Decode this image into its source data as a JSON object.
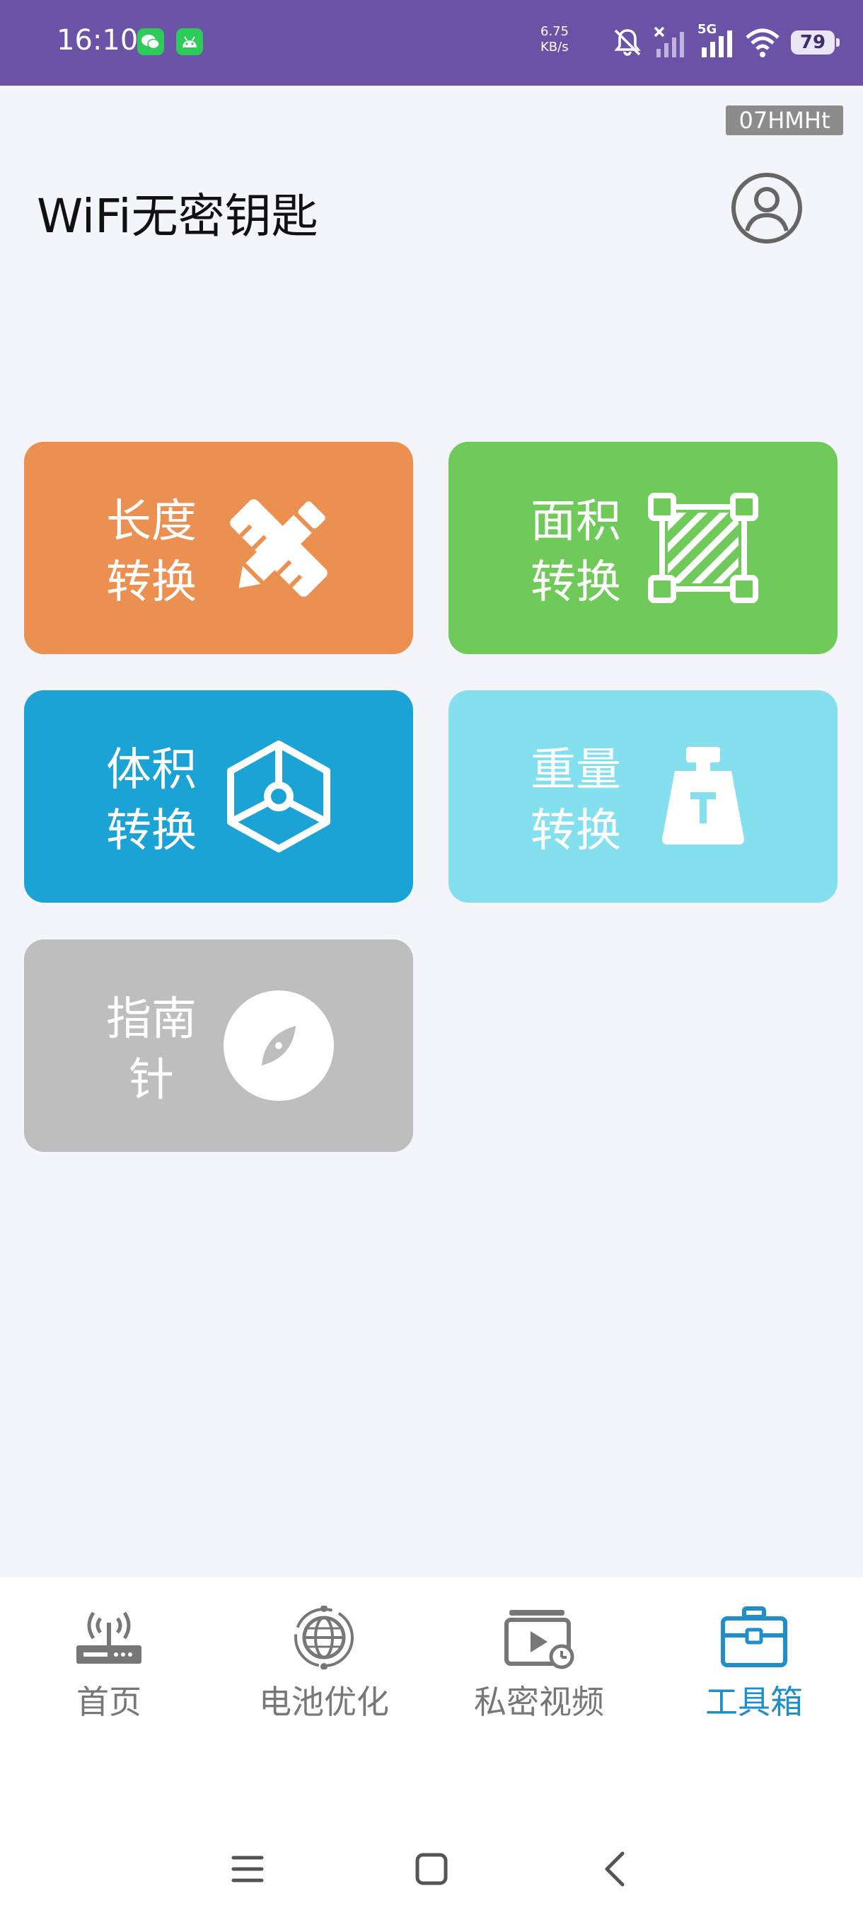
{
  "status_bar": {
    "time": "16:10",
    "net_speed_value": "6.75",
    "net_speed_unit": "KB/s",
    "network": "5G",
    "battery": "79",
    "icons": [
      "wechat-icon",
      "android-icon",
      "mute-icon",
      "no-signal-icon",
      "signal-icon",
      "wifi-icon",
      "battery-icon"
    ]
  },
  "app": {
    "tag": "07HMHt",
    "title": "WiFi无密钥匙",
    "account_icon": "account-icon"
  },
  "tools": [
    {
      "line1": "长度",
      "line2": "转换",
      "icon": "ruler-pencil-icon",
      "color": "#ec9052"
    },
    {
      "line1": "面积",
      "line2": "转换",
      "icon": "area-icon",
      "color": "#6fca5a"
    },
    {
      "line1": "体积",
      "line2": "转换",
      "icon": "cube-icon",
      "color": "#1aa3d4"
    },
    {
      "line1": "重量",
      "line2": "转换",
      "icon": "weight-icon",
      "color": "#84e0ef"
    },
    {
      "line1": "指南",
      "line2": "针",
      "icon": "compass-icon",
      "color": "#bebebe"
    }
  ],
  "nav": {
    "items": [
      {
        "label": "首页",
        "icon": "router-icon",
        "active": false
      },
      {
        "label": "电池优化",
        "icon": "globe-icon",
        "active": false
      },
      {
        "label": "私密视频",
        "icon": "video-icon",
        "active": false
      },
      {
        "label": "工具箱",
        "icon": "toolbox-icon",
        "active": true
      }
    ],
    "active_color": "#1e8fc9",
    "inactive_color": "#777777"
  },
  "system_nav": [
    "menu-icon",
    "home-icon",
    "back-icon"
  ]
}
